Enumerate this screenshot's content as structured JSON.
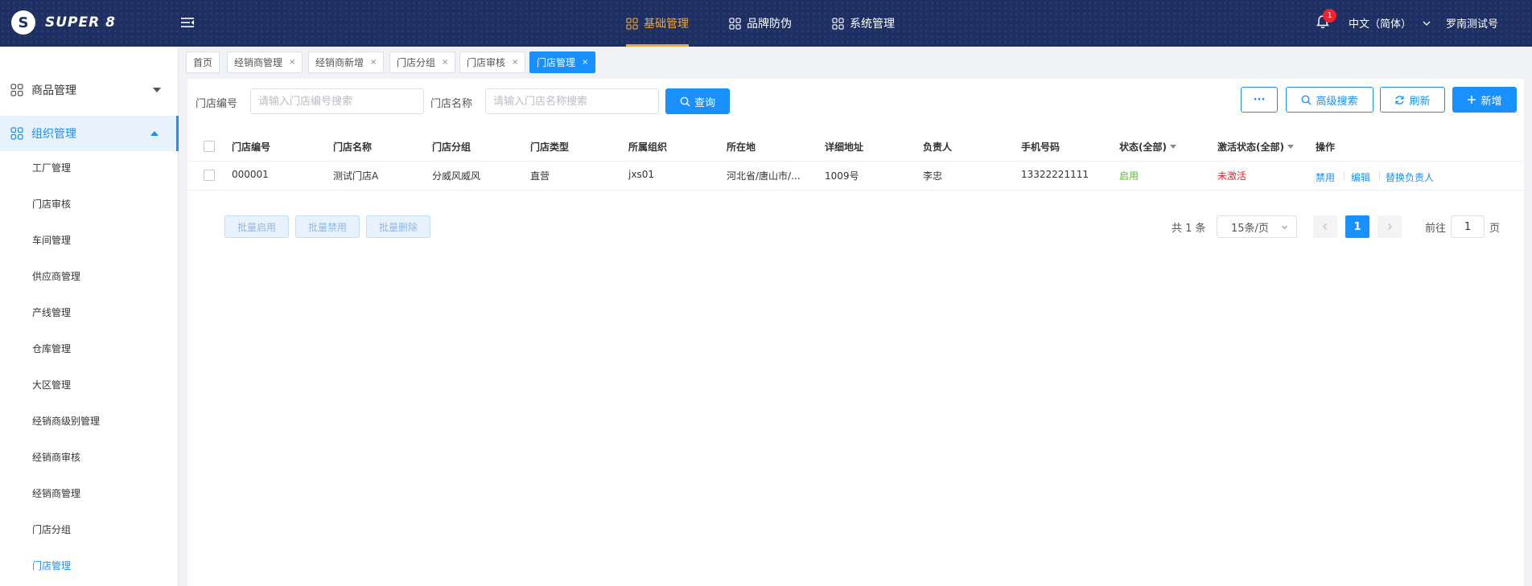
{
  "app": {
    "logo_mark": "S",
    "logo_text": "SUPER 8",
    "notifications": "1",
    "language": "中文（简体）",
    "username": "罗南测试号"
  },
  "topnav": [
    {
      "label": "基础管理",
      "active": true
    },
    {
      "label": "品牌防伪",
      "active": false
    },
    {
      "label": "系统管理",
      "active": false
    }
  ],
  "sidebar": {
    "groups": [
      {
        "label": "商品管理",
        "open": false
      },
      {
        "label": "组织管理",
        "open": true
      }
    ],
    "subitems": [
      "工厂管理",
      "门店审核",
      "车间管理",
      "供应商管理",
      "产线管理",
      "仓库管理",
      "大区管理",
      "经销商级别管理",
      "经销商审核",
      "经销商管理",
      "门店分组",
      "门店管理"
    ],
    "active_subitem": "门店管理"
  },
  "tabs": [
    {
      "label": "首页",
      "closable": false
    },
    {
      "label": "经销商管理",
      "closable": true
    },
    {
      "label": "经销商新增",
      "closable": true
    },
    {
      "label": "门店分组",
      "closable": true
    },
    {
      "label": "门店审核",
      "closable": true
    },
    {
      "label": "门店管理",
      "closable": true,
      "active": true
    }
  ],
  "tab_close_glyph": "×",
  "filters": {
    "store_code_label": "门店编号",
    "store_code_placeholder": "请输入门店编号搜索",
    "store_name_label": "门店名称",
    "store_name_placeholder": "请输入门店名称搜索",
    "query_button": "查询"
  },
  "toolbar": {
    "more_button": "···",
    "advanced_search_button": "高级搜索",
    "refresh_button": "刷新",
    "add_button": "新增"
  },
  "table": {
    "columns": [
      "门店编号",
      "门店名称",
      "门店分组",
      "门店类型",
      "所属组织",
      "所在地",
      "详细地址",
      "负责人",
      "手机号码",
      "状态(全部)",
      "激活状态(全部)",
      "操作"
    ],
    "rows": [
      {
        "code": "000001",
        "name": "测试门店A",
        "group": "分威风威风",
        "type": "直营",
        "org": "jxs01",
        "location": "河北省/唐山市/...",
        "address": "1009号",
        "manager": "李忠",
        "phone": "13322221111",
        "status": "启用",
        "activation": "未激活",
        "actions": [
          "禁用",
          "编辑",
          "替换负责人"
        ]
      }
    ]
  },
  "batch": {
    "enable_button": "批量启用",
    "disable_button": "批量禁用",
    "delete_button": "批量删除"
  },
  "pagination": {
    "total_text": "共 1 条",
    "page_size": "15条/页",
    "current_page": "1",
    "jump_prefix": "前往",
    "jump_value": "1",
    "jump_suffix": "页"
  },
  "colors": {
    "header_bg": "#1e2f63",
    "active_nav": "#f5a623",
    "primary": "#1890ff",
    "status_enabled": "#52c41a",
    "status_inactive": "#f5222d"
  }
}
